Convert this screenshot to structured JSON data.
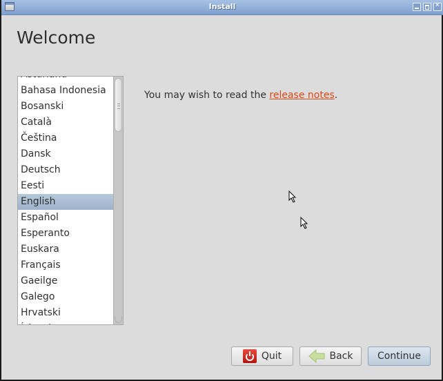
{
  "window": {
    "title": "Install",
    "controls": [
      "minimize",
      "maximize",
      "close"
    ]
  },
  "page": {
    "heading": "Welcome"
  },
  "language_list": {
    "items": [
      "Asturianu",
      "Bahasa Indonesia",
      "Bosanski",
      "Català",
      "Čeština",
      "Dansk",
      "Deutsch",
      "Eesti",
      "English",
      "Español",
      "Esperanto",
      "Euskara",
      "Français",
      "Gaeilge",
      "Galego",
      "Hrvatski",
      "Íslenska"
    ],
    "selected": "English"
  },
  "message": {
    "prefix": "You may wish to read the ",
    "link_text": "release notes",
    "suffix": ".",
    "link_color": "#dd4814"
  },
  "buttons": {
    "quit": "Quit",
    "back": "Back",
    "continue": "Continue"
  },
  "icons": {
    "quit": "power-icon",
    "back": "back-arrow-icon"
  }
}
